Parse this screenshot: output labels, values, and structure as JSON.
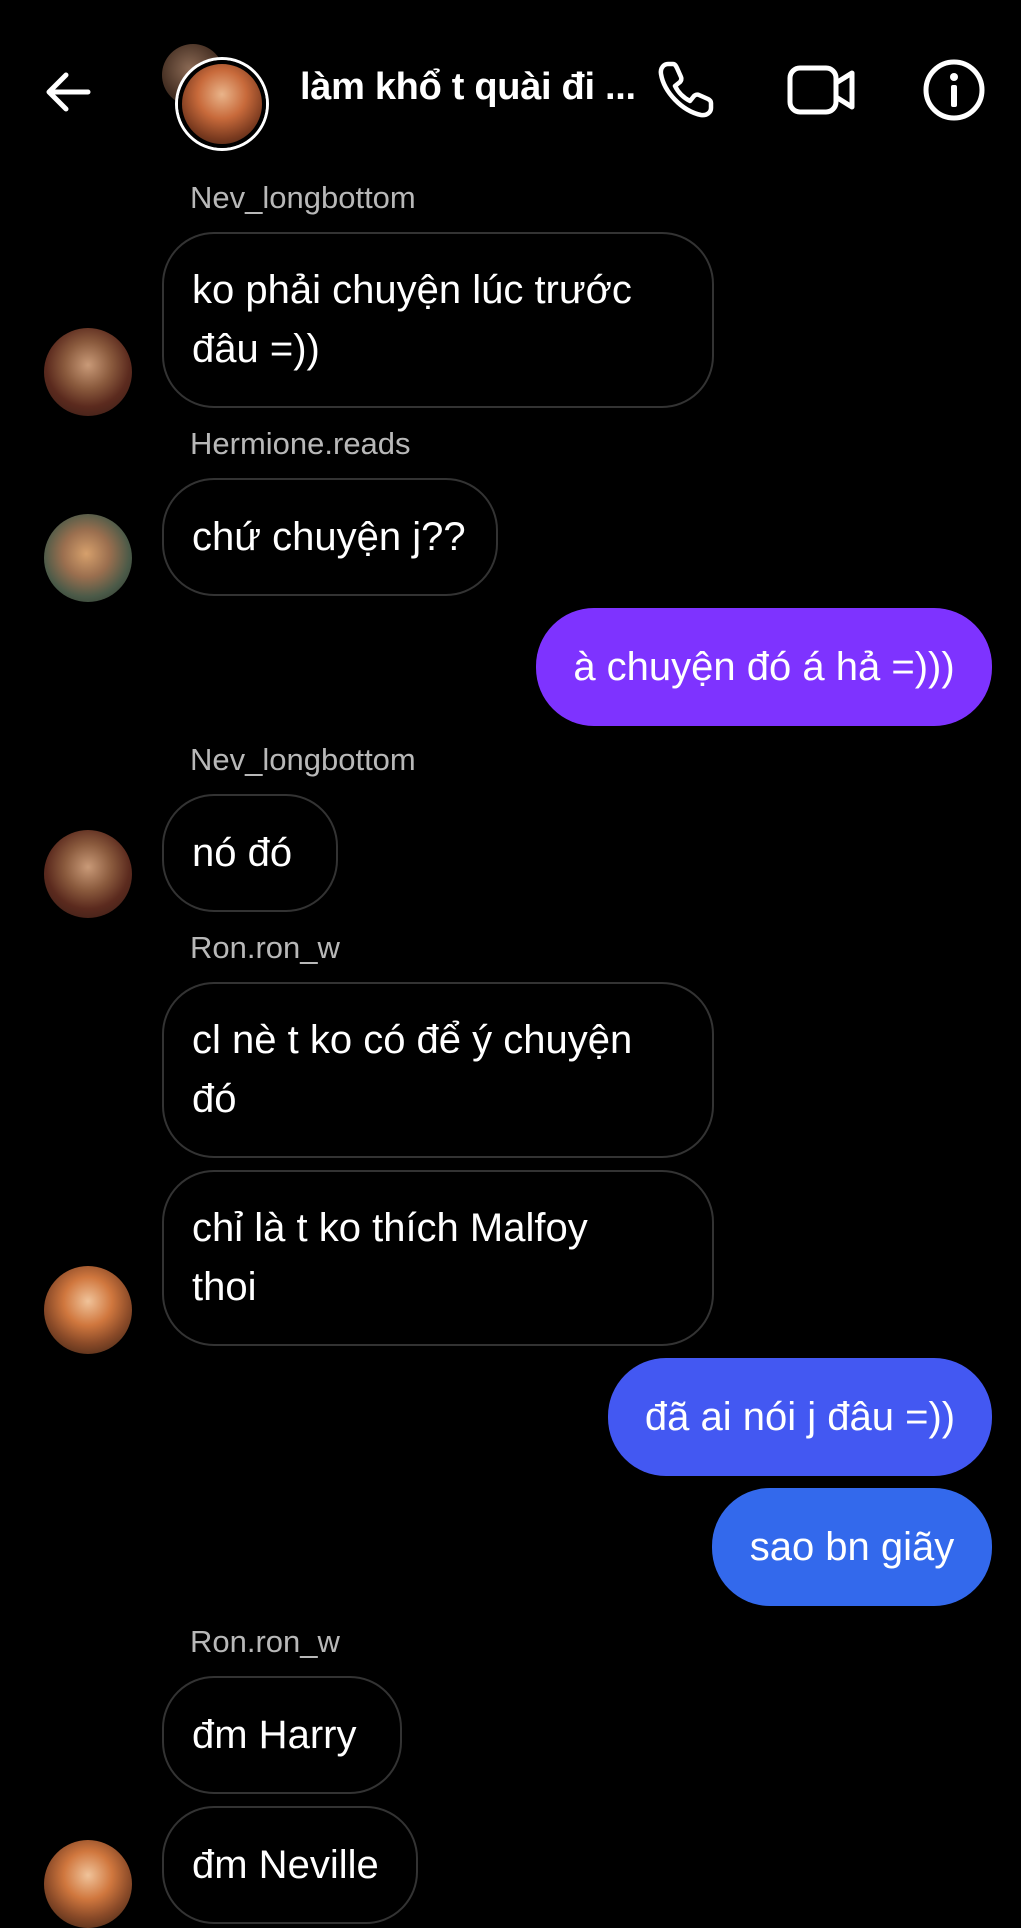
{
  "header": {
    "title": "làm khổ t quài đi ...",
    "icons": {
      "back": "arrow-left-icon",
      "call": "phone-icon",
      "video": "video-camera-icon",
      "info": "info-icon"
    }
  },
  "messages": {
    "s1": "Nev_longbottom",
    "m1": "ko phải chuyện lúc trước\nđâu =))",
    "s2": "Hermione.reads",
    "m2": "chứ chuyện j??",
    "m3": "à chuyện đó á hả =)))",
    "s3": "Nev_longbottom",
    "m4": "nó đó",
    "s4": "Ron.ron_w",
    "m5": "cl nè t ko có để ý chuyện\nđó",
    "m6": "chỉ là t ko thích Malfoy\nthoi",
    "m7": "đã ai nói j đâu =))",
    "m8": "sao bn giãy",
    "s5": "Ron.ron_w",
    "m9": "đm Harry",
    "m10": "đm Neville"
  },
  "colors": {
    "background": "#000000",
    "outgoing_purple": "#7e33ff",
    "outgoing_blue": "#4358f2",
    "outgoing_blue_2": "#3369ec",
    "incoming_border": "#333333",
    "sender_text": "#b8b8b8"
  }
}
